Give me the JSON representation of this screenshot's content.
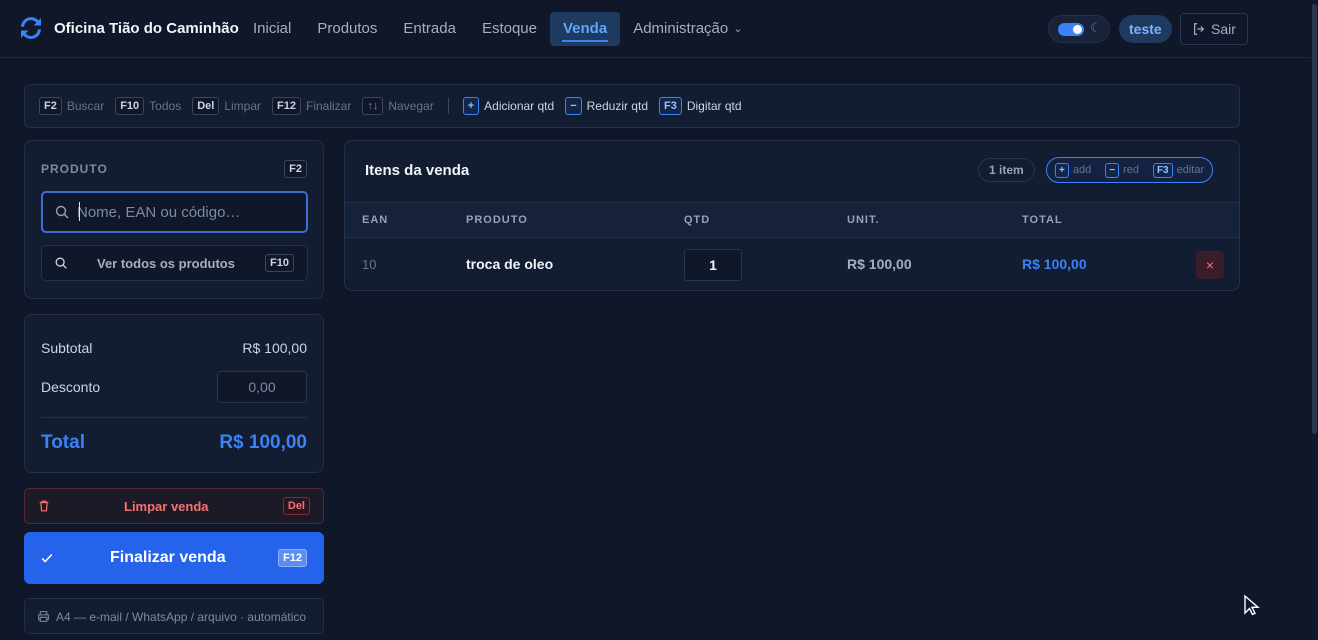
{
  "app": {
    "title": "Oficina Tião do Caminhão",
    "colors": {
      "accent": "#3b82f6",
      "danger": "#f87171",
      "background": "#0f1729"
    }
  },
  "nav": {
    "items": [
      {
        "label": "Inicial",
        "active": false
      },
      {
        "label": "Produtos",
        "active": false
      },
      {
        "label": "Entrada",
        "active": false
      },
      {
        "label": "Estoque",
        "active": false
      },
      {
        "label": "Venda",
        "active": true
      },
      {
        "label": "Administração",
        "active": false,
        "dropdown": true
      }
    ]
  },
  "header": {
    "theme_toggle": {
      "on": true,
      "icon": "moon-icon"
    },
    "user": "teste",
    "logout_label": "Sair"
  },
  "shortcuts": [
    {
      "key": "F2",
      "label": "Buscar"
    },
    {
      "key": "F10",
      "label": "Todos"
    },
    {
      "key": "Del",
      "label": "Limpar"
    },
    {
      "key": "F12",
      "label": "Finalizar"
    },
    {
      "key": "↑↓",
      "label": "Navegar"
    },
    {
      "key": "+",
      "label": "Adicionar qtd"
    },
    {
      "key": "−",
      "label": "Reduzir qtd"
    },
    {
      "key": "F3",
      "label": "Digitar qtd"
    }
  ],
  "product_panel": {
    "label": "PRODUTO",
    "key": "F2",
    "search_placeholder": "Nome, EAN ou código…",
    "all_products_label": "Ver todos os produtos",
    "all_products_key": "F10"
  },
  "totals": {
    "subtotal_label": "Subtotal",
    "subtotal_value": "R$ 100,00",
    "discount_label": "Desconto",
    "discount_value": "0,00",
    "total_label": "Total",
    "total_value": "R$ 100,00"
  },
  "actions": {
    "clear_label": "Limpar venda",
    "clear_key": "Del",
    "finish_label": "Finalizar venda",
    "finish_key": "F12",
    "print_note": "A4 — e-mail / WhatsApp / arquivo · automático"
  },
  "items": {
    "title": "Itens da venda",
    "count": "1 item",
    "hints": [
      {
        "key": "+",
        "label": "add"
      },
      {
        "key": "−",
        "label": "red"
      },
      {
        "key": "F3",
        "label": "editar"
      }
    ],
    "columns": [
      "EAN",
      "PRODUTO",
      "QTD",
      "UNIT.",
      "TOTAL"
    ],
    "rows": [
      {
        "ean": "10",
        "product": "troca de oleo",
        "qty": "1",
        "unit": "R$ 100,00",
        "total": "R$ 100,00",
        "remove": "×"
      }
    ]
  }
}
